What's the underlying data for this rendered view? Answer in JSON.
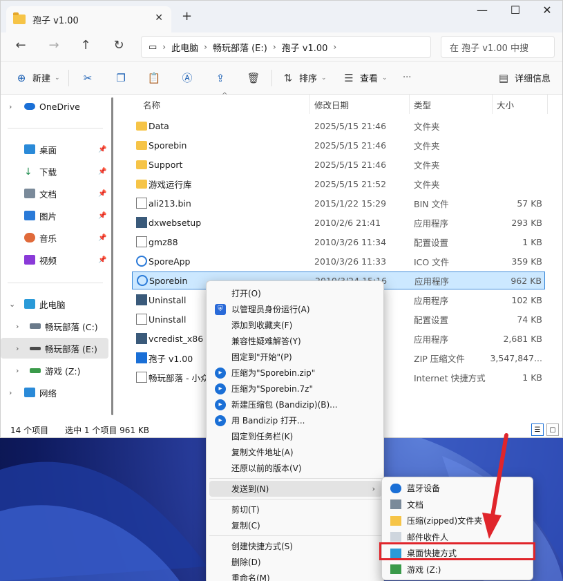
{
  "window": {
    "tab_title": "孢子 v1.00",
    "new_tab": "+",
    "minimize": "—",
    "maximize": "☐",
    "close": "✕"
  },
  "address": {
    "crumbs": [
      "此电脑",
      "畅玩部落 (E:)",
      "孢子 v1.00"
    ],
    "search_placeholder": "在 孢子 v1.00 中搜"
  },
  "toolbar": {
    "new": "新建",
    "sort": "排序",
    "view": "查看",
    "details": "详细信息"
  },
  "sidebar": {
    "onedrive": "OneDrive",
    "quick": [
      "桌面",
      "下载",
      "文档",
      "图片",
      "音乐",
      "视频"
    ],
    "pc": "此电脑",
    "drives": [
      "畅玩部落 (C:)",
      "畅玩部落 (E:)",
      "游戏 (Z:)"
    ],
    "network": "网络"
  },
  "columns": {
    "name": "名称",
    "date": "修改日期",
    "type": "类型",
    "size": "大小"
  },
  "files": [
    {
      "name": "Data",
      "date": "2025/5/15 21:46",
      "type": "文件夹",
      "size": ""
    },
    {
      "name": "Sporebin",
      "date": "2025/5/15 21:46",
      "type": "文件夹",
      "size": ""
    },
    {
      "name": "Support",
      "date": "2025/5/15 21:46",
      "type": "文件夹",
      "size": ""
    },
    {
      "name": "游戏运行库",
      "date": "2025/5/15 21:52",
      "type": "文件夹",
      "size": ""
    },
    {
      "name": "ali213.bin",
      "date": "2015/1/22 15:29",
      "type": "BIN 文件",
      "size": "57 KB"
    },
    {
      "name": "dxwebsetup",
      "date": "2010/2/6 21:41",
      "type": "应用程序",
      "size": "293 KB"
    },
    {
      "name": "gmz88",
      "date": "2010/3/26 11:34",
      "type": "配置设置",
      "size": "1 KB"
    },
    {
      "name": "SporeApp",
      "date": "2010/3/26 11:33",
      "type": "ICO 文件",
      "size": "359 KB"
    },
    {
      "name": "Sporebin",
      "date": "2010/3/24 15:16",
      "type": "应用程序",
      "size": "962 KB"
    },
    {
      "name": "Uninstall",
      "date": "",
      "type": "应用程序",
      "size": "102 KB"
    },
    {
      "name": "Uninstall",
      "date": "",
      "type": "配置设置",
      "size": "74 KB"
    },
    {
      "name": "vcredist_x86",
      "date": "",
      "type": "应用程序",
      "size": "2,681 KB"
    },
    {
      "name": "孢子 v1.00",
      "date": "",
      "type": "ZIP 压缩文件",
      "size": "3,547,847..."
    },
    {
      "name": "畅玩部落 - 小众",
      "date": "",
      "type": "Internet 快捷方式",
      "size": "1 KB"
    }
  ],
  "status": {
    "count": "14 个项目",
    "selected": "选中 1 个项目  961 KB"
  },
  "context_menu": [
    "打开(O)",
    "以管理员身份运行(A)",
    "添加到收藏夹(F)",
    "兼容性疑难解答(Y)",
    "固定到\"开始\"(P)",
    "压缩为\"Sporebin.zip\"",
    "压缩为\"Sporebin.7z\"",
    "新建压缩包 (Bandizip)(B)...",
    "用 Bandizip 打开...",
    "固定到任务栏(K)",
    "复制文件地址(A)",
    "还原以前的版本(V)",
    "发送到(N)",
    "剪切(T)",
    "复制(C)",
    "创建快捷方式(S)",
    "删除(D)",
    "重命名(M)"
  ],
  "send_to": [
    "蓝牙设备",
    "文档",
    "压缩(zipped)文件夹",
    "邮件收件人",
    "桌面快捷方式",
    "游戏 (Z:)"
  ],
  "colors": {
    "accent": "#1a6fd6",
    "highlight": "#e0252b",
    "selection": "#cce8ff",
    "folder": "#f6c447"
  }
}
